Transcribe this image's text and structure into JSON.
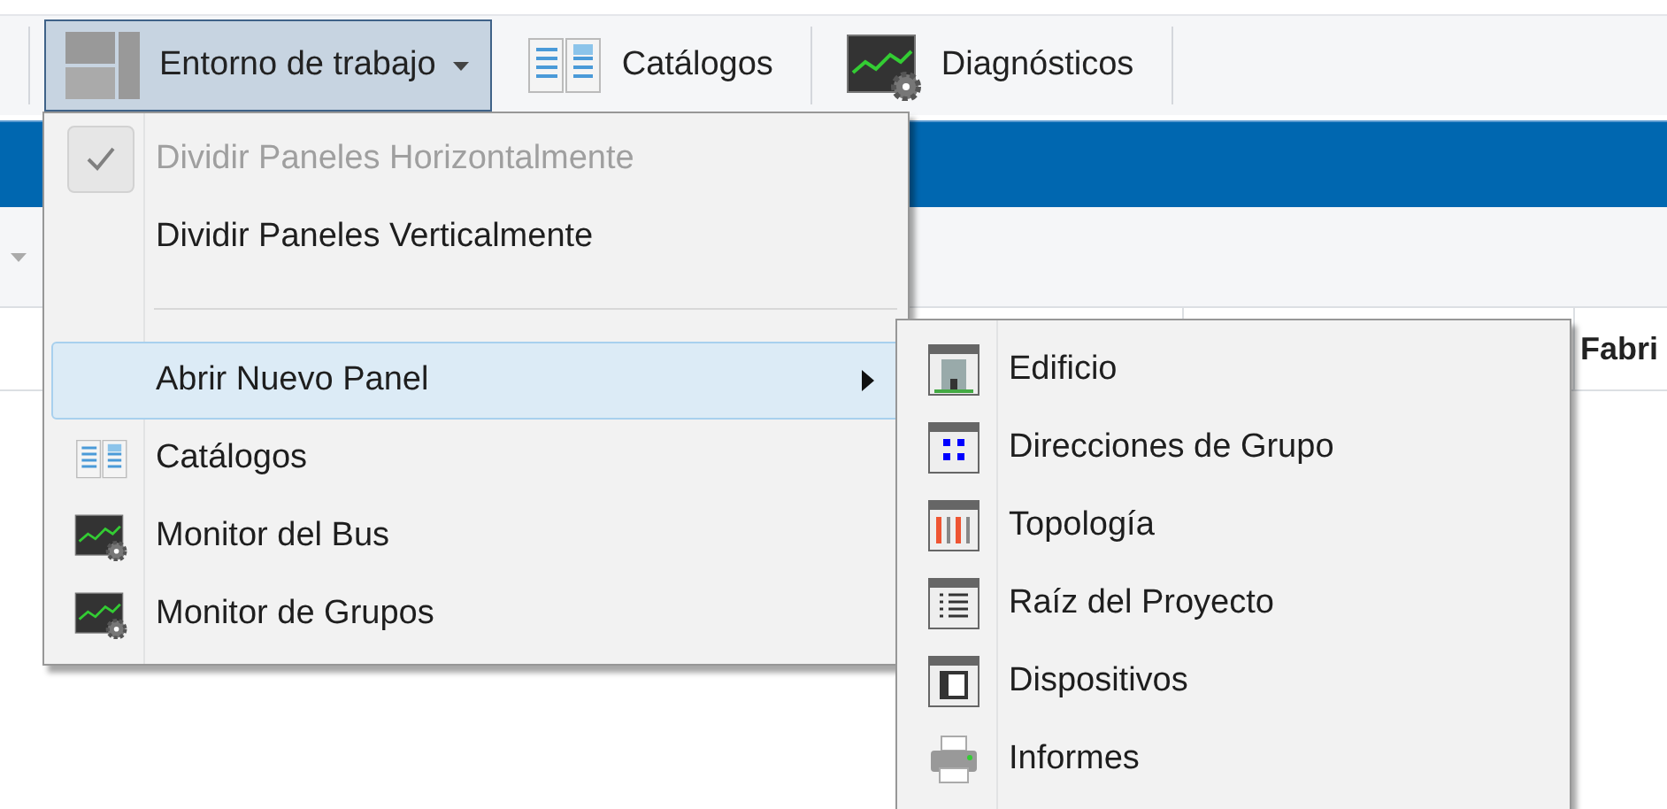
{
  "toolbar": {
    "buttons": [
      {
        "label": "Entorno de trabajo",
        "selected": true,
        "dropdown": true
      },
      {
        "label": "Catálogos",
        "selected": false,
        "dropdown": false
      },
      {
        "label": "Diagnósticos",
        "selected": false,
        "dropdown": false
      }
    ]
  },
  "table": {
    "visible_headers": [
      "Fabri"
    ]
  },
  "menu": {
    "items": [
      {
        "kind": "check",
        "label": "Dividir Paneles Horizontalmente",
        "checked": true,
        "disabled": true,
        "highlighted": false
      },
      {
        "kind": "check",
        "label": "Dividir Paneles Verticalmente",
        "checked": false,
        "disabled": false,
        "highlighted": false
      },
      {
        "kind": "separator"
      },
      {
        "kind": "submenu",
        "label": "Abrir Nuevo Panel",
        "highlighted": true
      },
      {
        "kind": "icon",
        "label": "Catálogos",
        "highlighted": false
      },
      {
        "kind": "icon",
        "label": "Monitor del Bus",
        "highlighted": false
      },
      {
        "kind": "icon",
        "label": "Monitor de Grupos",
        "highlighted": false
      }
    ]
  },
  "submenu": {
    "items": [
      {
        "label": "Edificio"
      },
      {
        "label": "Direcciones de Grupo"
      },
      {
        "label": "Topología"
      },
      {
        "label": "Raíz del Proyecto"
      },
      {
        "label": "Dispositivos"
      },
      {
        "label": "Informes"
      }
    ]
  }
}
